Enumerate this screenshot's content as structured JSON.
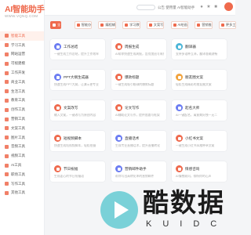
{
  "brand": {
    "title": "AI智能助手",
    "subtitle": "WWW.VQNQ.COM",
    "accent": "#ef6a4d"
  },
  "sidebar": {
    "items": [
      {
        "label": "智能工具",
        "active": true
      },
      {
        "label": "学习工具"
      },
      {
        "label": "网站运营"
      },
      {
        "label": "可视建模"
      },
      {
        "label": "工作开发"
      },
      {
        "label": "商业工具"
      },
      {
        "label": "生活工具"
      },
      {
        "label": "教育工具"
      },
      {
        "label": "创作工具"
      },
      {
        "label": "营销工具"
      },
      {
        "label": "文案工具"
      },
      {
        "label": "图片工具"
      },
      {
        "label": "音频工具"
      },
      {
        "label": "视频工具"
      },
      {
        "label": "AI工具"
      },
      {
        "label": "职场工具"
      },
      {
        "label": "写作工具"
      },
      {
        "label": "其他工具"
      }
    ]
  },
  "header": {
    "notice": "公告 使用量 AI智能助手",
    "icons": [
      "search-icon",
      "bell-icon",
      "star-icon",
      "message-icon",
      "user-icon"
    ]
  },
  "tabs": [
    {
      "label": "全部",
      "active": true
    },
    {
      "label": "智能办公"
    },
    {
      "label": "编程辅助"
    },
    {
      "label": "学习教育"
    },
    {
      "label": "文案写作"
    },
    {
      "label": "AI绘画"
    },
    {
      "label": "营销推广"
    },
    {
      "label": "更多工具"
    }
  ],
  "cards": [
    {
      "title": "工作总结",
      "desc": "一键生成工作总结，提升工作效率",
      "color": "#6c7df2"
    },
    {
      "title": "周报生成",
      "desc": "AI帮你快速生成周报，告别加班写周报",
      "color": "#ef6a4d"
    },
    {
      "title": "翻译器",
      "desc": "支持多语种互译，翻译准确流畅",
      "color": "#4cb6d8"
    },
    {
      "title": "PPT大纲生成器",
      "desc": "快速生成PPT大纲，让演示更专业",
      "color": "#6c7df2"
    },
    {
      "title": "爆款标题",
      "desc": "一键生成吸引眼球的爆款标题",
      "color": "#ef6a4d"
    },
    {
      "title": "朋友圈文案",
      "desc": "轻松生成精彩的朋友圈文案",
      "color": "#f2a33c"
    },
    {
      "title": "文案改写",
      "desc": "输入文案，一键改写为原创内容",
      "color": "#ef6a4d"
    },
    {
      "title": "论文写作",
      "desc": "AI辅助论文写作，提供思路与框架",
      "color": "#ef6a4d"
    },
    {
      "title": "起名大师",
      "desc": "AI一键起名，寓意美好独一无二",
      "color": "#6c7df2"
    },
    {
      "title": "短视频脚本",
      "desc": "快速生成短视频脚本，轻松拍摄",
      "color": "#ef6a4d"
    },
    {
      "title": "直播话术",
      "desc": "生成专业直播话术，提升直播转化",
      "color": "#6c7df2"
    },
    {
      "title": "小红书文案",
      "desc": "一键生成小红书风格种草文案",
      "color": "#ef6a4d"
    },
    {
      "title": "节日祝福",
      "desc": "生成走心的节日祝福语",
      "color": "#ef6a4d"
    },
    {
      "title": "营销邮件助手",
      "desc": "帮你写出高转化率的营销邮件",
      "color": "#6c7df2"
    },
    {
      "title": "情感咨询",
      "desc": "AI情感顾问，倾听你的心声",
      "color": "#ef6a4d"
    }
  ],
  "watermark": {
    "text": "酷数据",
    "sub": "KUIDC",
    "color": "#7ad1d8"
  }
}
